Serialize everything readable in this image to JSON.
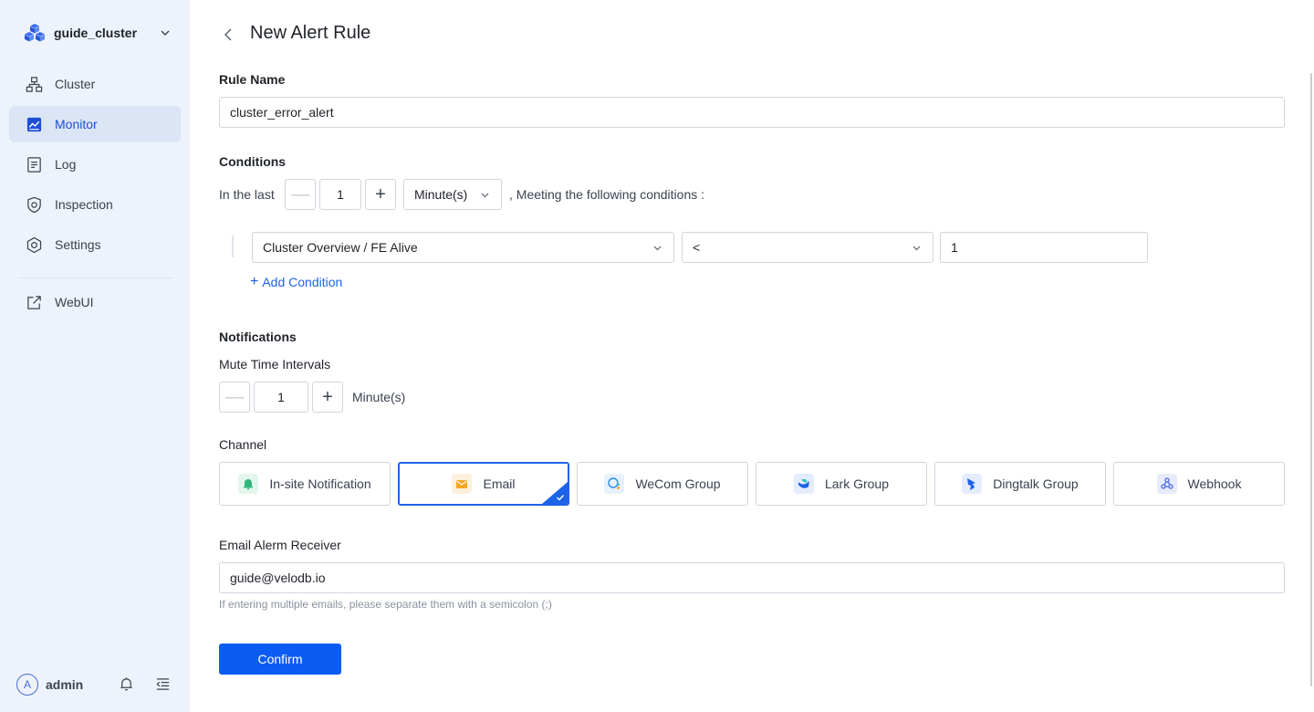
{
  "sidebar": {
    "cluster_name": "guide_cluster",
    "items": [
      {
        "label": "Cluster",
        "icon": "cluster-icon"
      },
      {
        "label": "Monitor",
        "icon": "monitor-icon",
        "active": true
      },
      {
        "label": "Log",
        "icon": "log-icon"
      },
      {
        "label": "Inspection",
        "icon": "inspection-icon"
      },
      {
        "label": "Settings",
        "icon": "settings-icon"
      },
      {
        "label": "WebUI",
        "icon": "external-link-icon"
      }
    ],
    "user": {
      "avatar_letter": "A",
      "name": "admin"
    }
  },
  "page": {
    "title": "New Alert Rule",
    "rule_name_label": "Rule Name",
    "rule_name_value": "cluster_error_alert",
    "conditions": {
      "label": "Conditions",
      "prefix": "In the last",
      "minus": "—",
      "plus": "+",
      "count": "1",
      "unit": "Minute(s)",
      "suffix": ", Meeting the following conditions :",
      "metric": "Cluster Overview / FE Alive",
      "operator": "<",
      "threshold": "1",
      "add_label": "Add Condition"
    },
    "notifications": {
      "label": "Notifications",
      "mute_label": "Mute Time Intervals",
      "minus": "—",
      "plus": "+",
      "mute_value": "1",
      "mute_unit": "Minute(s)"
    },
    "channel": {
      "label": "Channel",
      "options": [
        {
          "label": "In-site Notification",
          "icon": "bell-icon",
          "color": "#2fb57a"
        },
        {
          "label": "Email",
          "icon": "email-icon",
          "color": "#f5a623",
          "selected": true
        },
        {
          "label": "WeCom Group",
          "icon": "wecom-icon",
          "color": "#2a8cf0"
        },
        {
          "label": "Lark Group",
          "icon": "lark-icon",
          "color": "#1d63e8"
        },
        {
          "label": "Dingtalk Group",
          "icon": "dingtalk-icon",
          "color": "#1d63e8"
        },
        {
          "label": "Webhook",
          "icon": "webhook-icon",
          "color": "#4a6ad9"
        }
      ]
    },
    "email": {
      "label": "Email Alerm Receiver",
      "value": "guide@velodb.io",
      "hint": "If entering multiple emails, please separate them with a semicolon (;)"
    },
    "confirm_label": "Confirm"
  }
}
